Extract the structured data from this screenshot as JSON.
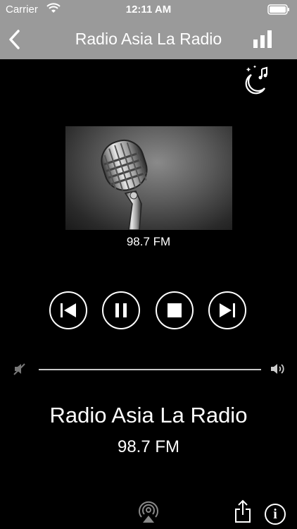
{
  "status_bar": {
    "carrier": "Carrier",
    "time": "12:11 AM"
  },
  "nav": {
    "title": "Radio Asia La Radio",
    "back_icon": "chevron-left-icon",
    "stats_icon": "bar-chart-icon"
  },
  "sleep_icon": "sleep-timer-moon-icon",
  "artwork": {
    "frequency_label": "98.7 FM"
  },
  "controls": {
    "previous_icon": "skip-previous-icon",
    "pause_icon": "pause-icon",
    "stop_icon": "stop-icon",
    "next_icon": "skip-next-icon"
  },
  "volume": {
    "level": 1.0,
    "min_icon": "volume-mute-icon",
    "max_icon": "volume-high-icon"
  },
  "now_playing": {
    "station": "Radio Asia La Radio",
    "frequency": "98.7 FM"
  },
  "footer": {
    "airplay_icon": "airplay-icon",
    "share_icon": "share-icon",
    "info_icon": "info-icon"
  },
  "colors": {
    "bar": "#9a9a9a",
    "background": "#000000",
    "foreground": "#ffffff"
  }
}
